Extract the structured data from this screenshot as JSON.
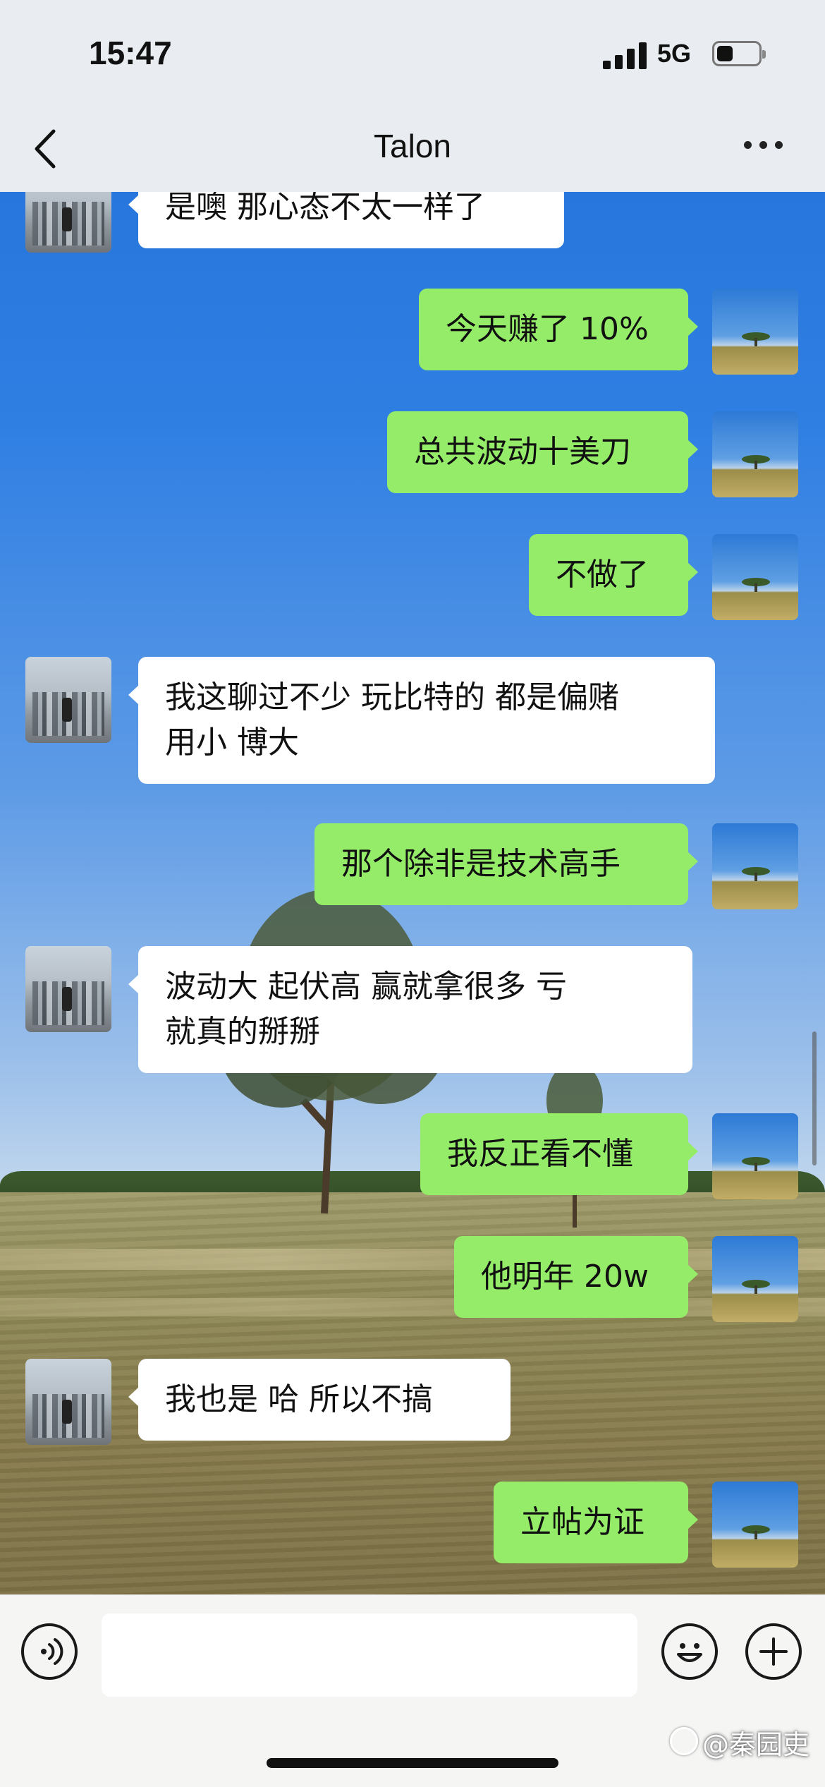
{
  "status_bar": {
    "time": "15:47",
    "network": "5G"
  },
  "header": {
    "title": "Talon"
  },
  "messages": [
    {
      "side": "left",
      "avatar": "city-photo-avatar",
      "text": "是噢  那心态不太一样了"
    },
    {
      "side": "right",
      "avatar": "field-photo-avatar",
      "text": "今天赚了 10%"
    },
    {
      "side": "right",
      "avatar": "field-photo-avatar",
      "text": "总共波动十美刀"
    },
    {
      "side": "right",
      "avatar": "field-photo-avatar",
      "text": "不做了"
    },
    {
      "side": "left",
      "avatar": "city-photo-avatar",
      "text": "我这聊过不少 玩比特的  都是偏赌\n用小 博大"
    },
    {
      "side": "right",
      "avatar": "field-photo-avatar",
      "text": "那个除非是技术高手"
    },
    {
      "side": "left",
      "avatar": "city-photo-avatar",
      "text": "波动大  起伏高  赢就拿很多    亏\n就真的掰掰"
    },
    {
      "side": "right",
      "avatar": "field-photo-avatar",
      "text": "我反正看不懂"
    },
    {
      "side": "right",
      "avatar": "field-photo-avatar",
      "text": "他明年 20w"
    },
    {
      "side": "left",
      "avatar": "city-photo-avatar",
      "text": "我也是  哈  所以不搞"
    },
    {
      "side": "right",
      "avatar": "field-photo-avatar",
      "text": "立帖为证"
    }
  ],
  "input_bar": {
    "text_value": ""
  },
  "watermark": {
    "text": "@秦园吏"
  },
  "icons": {
    "back": "chevron-left-icon",
    "more": "ellipsis-icon",
    "voice": "voice-icon",
    "emoji": "emoji-icon",
    "add": "plus-icon"
  },
  "colors": {
    "bubble_outgoing": "#95ec69",
    "bubble_incoming": "#ffffff",
    "bar_background": "#e9edf1",
    "input_bar_background": "#f5f5f4"
  }
}
